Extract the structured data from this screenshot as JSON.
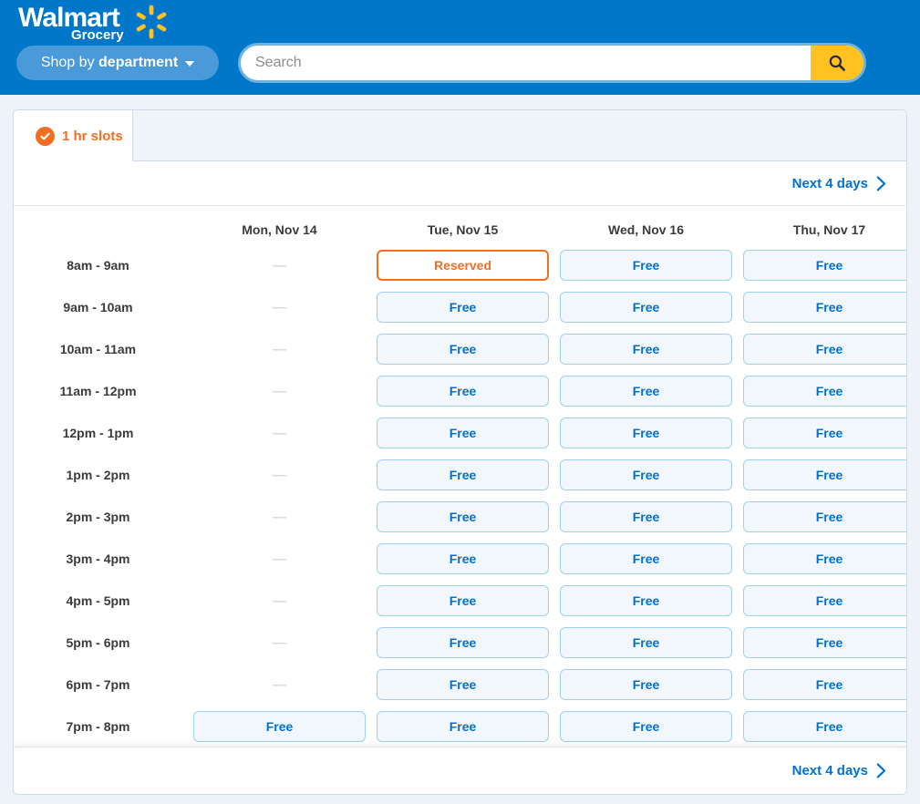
{
  "header": {
    "brand_name": "Walmart",
    "brand_sub": "Grocery",
    "spark_icon": "walmart-spark-icon",
    "dept_button": {
      "label_regular": "Shop by ",
      "label_bold": "department",
      "caret_icon": "chevron-down-icon"
    },
    "search": {
      "placeholder": "Search",
      "value": "",
      "submit_icon": "search-icon"
    },
    "colors": {
      "header_blue": "#0077c8",
      "dept_blue": "#4a99d8",
      "search_button_yellow": "#ffc220",
      "spark_yellow": "#ffc220"
    }
  },
  "tabs": [
    {
      "label": "1 hr slots",
      "icon": "check-circle-icon",
      "active": true,
      "accent_color": "#f26e21"
    }
  ],
  "nav": {
    "next_label": "Next 4 days",
    "next_icon": "chevron-right-icon",
    "link_color": "#0071ce"
  },
  "footer": {
    "next_label": "Next 4 days",
    "next_icon": "chevron-right-icon"
  },
  "schedule": {
    "day_headers": [
      "Mon, Nov 14",
      "Tue, Nov 15",
      "Wed, Nov 16",
      "Thu, Nov 17"
    ],
    "time_labels": [
      "8am - 9am",
      "9am - 10am",
      "10am - 11am",
      "11am - 12pm",
      "12pm - 1pm",
      "1pm - 2pm",
      "2pm - 3pm",
      "3pm - 4pm",
      "4pm - 5pm",
      "5pm - 6pm",
      "6pm - 7pm",
      "7pm - 8pm"
    ],
    "status_labels": {
      "free": "Free",
      "reserved": "Reserved",
      "unavailable": "—"
    },
    "rows": [
      {
        "time": "8am - 9am",
        "cells": [
          "unavailable",
          "reserved",
          "free",
          "free"
        ]
      },
      {
        "time": "9am - 10am",
        "cells": [
          "unavailable",
          "free",
          "free",
          "free"
        ]
      },
      {
        "time": "10am - 11am",
        "cells": [
          "unavailable",
          "free",
          "free",
          "free"
        ]
      },
      {
        "time": "11am - 12pm",
        "cells": [
          "unavailable",
          "free",
          "free",
          "free"
        ]
      },
      {
        "time": "12pm - 1pm",
        "cells": [
          "unavailable",
          "free",
          "free",
          "free"
        ]
      },
      {
        "time": "1pm - 2pm",
        "cells": [
          "unavailable",
          "free",
          "free",
          "free"
        ]
      },
      {
        "time": "2pm - 3pm",
        "cells": [
          "unavailable",
          "free",
          "free",
          "free"
        ]
      },
      {
        "time": "3pm - 4pm",
        "cells": [
          "unavailable",
          "free",
          "free",
          "free"
        ]
      },
      {
        "time": "4pm - 5pm",
        "cells": [
          "unavailable",
          "free",
          "free",
          "free"
        ]
      },
      {
        "time": "5pm - 6pm",
        "cells": [
          "unavailable",
          "free",
          "free",
          "free"
        ]
      },
      {
        "time": "6pm - 7pm",
        "cells": [
          "unavailable",
          "free",
          "free",
          "free"
        ]
      },
      {
        "time": "7pm - 8pm",
        "cells": [
          "free",
          "free",
          "free",
          "free"
        ]
      }
    ],
    "colors": {
      "free_text": "#0071ce",
      "free_bg": "#f2f7fd",
      "free_border": "#9fd0ef",
      "reserved_accent": "#f26e21",
      "unavailable": "#d9d9d9"
    }
  }
}
